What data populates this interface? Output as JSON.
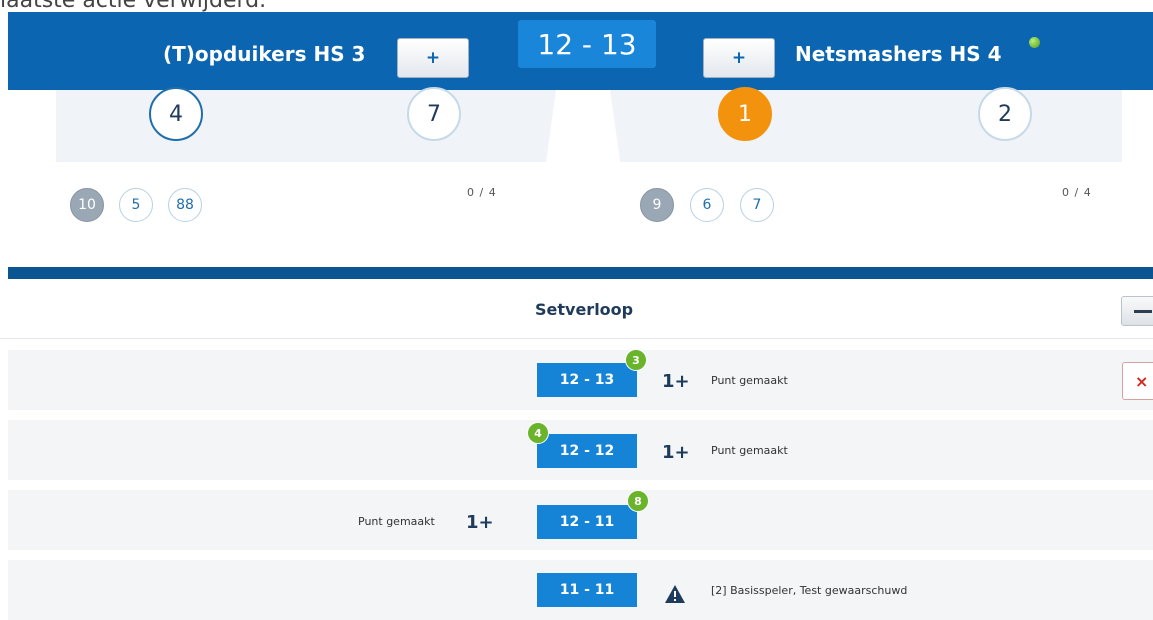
{
  "caption": "laatste actie verwijderd.",
  "header": {
    "home_team": "(T)opduikers HS 3",
    "away_team": "Netsmashers HS 4",
    "plus_label": "+",
    "score": "12 - 13"
  },
  "rotation": {
    "home": [
      "4",
      "7"
    ],
    "away": [
      "1",
      "2"
    ]
  },
  "bench": {
    "home": [
      "10",
      "5",
      "88"
    ],
    "away": [
      "9",
      "6",
      "7"
    ],
    "home_subs": "0 / 4",
    "away_subs": "0 / 4"
  },
  "setverloop": {
    "title": "Setverloop",
    "rows": [
      {
        "score": "12 - 13",
        "badge": "3",
        "plus": "1+",
        "text": "Punt gemaakt"
      },
      {
        "score": "12 - 12",
        "badge": "4",
        "plus": "1+",
        "text": "Punt gemaakt"
      },
      {
        "score": "12 - 11",
        "badge": "8",
        "plus": "1+",
        "text": "Punt gemaakt"
      },
      {
        "score": "11 - 11",
        "text": "[2]  Basisspeler, Test gewaarschuwd"
      }
    ],
    "delete_label": "×"
  },
  "colors": {
    "header_blue": "#0b65b0",
    "score_blue": "#1584d6",
    "serve_orange": "#f3920c",
    "badge_green": "#6ab42c",
    "delete_red": "#d0281f"
  },
  "icons": {
    "collapse": "minus-icon",
    "warning": "warning-triangle-icon",
    "online": "online-status-icon"
  }
}
